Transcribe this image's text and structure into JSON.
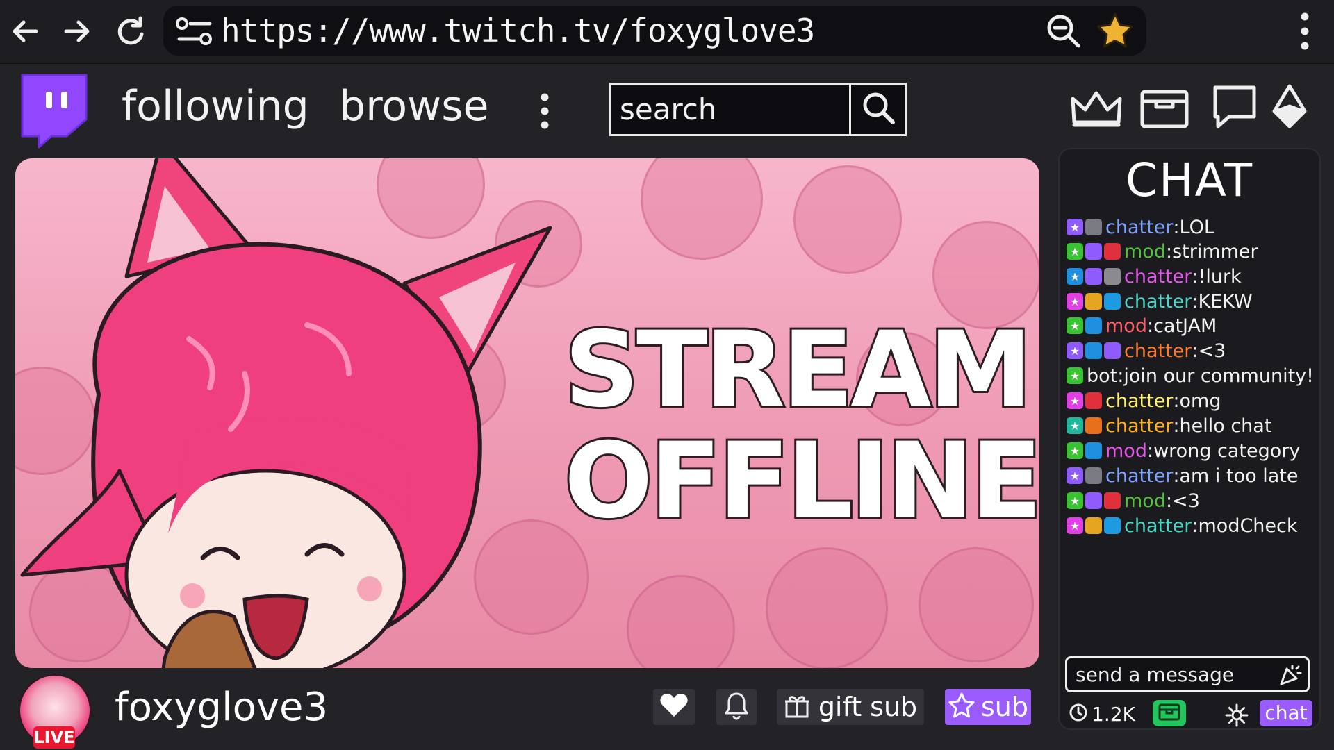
{
  "browser": {
    "url": "https://www.twitch.tv/foxyglove3"
  },
  "header": {
    "following_label": "following",
    "browse_label": "browse",
    "search_placeholder": "search"
  },
  "player": {
    "offline_line1": "STREAM",
    "offline_line2": "OFFLINE"
  },
  "chat": {
    "title": "CHAT",
    "message_placeholder": "send a message",
    "viewer_count": "1.2K",
    "chat_button_label": "chat",
    "messages": [
      {
        "badges": [
          "#8f5bff",
          "#7a7a82"
        ],
        "user": "chatter",
        "color": "#7ea3ff",
        "text": "LOL"
      },
      {
        "badges": [
          "#39c232",
          "#8f5bff",
          "#e0303c"
        ],
        "user": "mod",
        "color": "#54c13a",
        "text": "strimmer"
      },
      {
        "badges": [
          "#1f8fe0",
          "#8f5bff",
          "#8a8a90"
        ],
        "user": "chatter",
        "color": "#e557e8",
        "text": "!lurk"
      },
      {
        "badges": [
          "#e23fe6",
          "#e6a520",
          "#1c9be2"
        ],
        "user": "chatter",
        "color": "#48d6c6",
        "text": "KEKW"
      },
      {
        "badges": [
          "#39c232",
          "#1f8fe0"
        ],
        "user": "mod",
        "color": "#ff5f6a",
        "text": "catJAM"
      },
      {
        "badges": [
          "#8f5bff",
          "#1f8fe0",
          "#8f5bff"
        ],
        "user": "chatter",
        "color": "#ff7a2a",
        "text": "<3"
      },
      {
        "badges": [
          "#39c232"
        ],
        "user": "bot",
        "color": "#f2f2f2",
        "text": "join our community!"
      },
      {
        "badges": [
          "#e23fe6",
          "#e0303c"
        ],
        "user": "chatter",
        "color": "#fff06a",
        "text": "omg"
      },
      {
        "badges": [
          "#20b89c",
          "#e6701c"
        ],
        "user": "chatter",
        "color": "#ffb11a",
        "text": "hello chat"
      },
      {
        "badges": [
          "#39c232",
          "#1f8fe0"
        ],
        "user": "mod",
        "color": "#e557e8",
        "text": "wrong category"
      },
      {
        "badges": [
          "#8f5bff",
          "#7a7a82"
        ],
        "user": "chatter",
        "color": "#7ea3ff",
        "text": "am i too late"
      },
      {
        "badges": [
          "#39c232",
          "#8f5bff",
          "#e0303c"
        ],
        "user": "mod",
        "color": "#54c13a",
        "text": "<3"
      },
      {
        "badges": [
          "#e23fe6",
          "#e6a520",
          "#1c9be2"
        ],
        "user": "chatter",
        "color": "#48d6c6",
        "text": "modCheck"
      }
    ]
  },
  "channel": {
    "name": "foxyglove3",
    "live_badge": "LIVE",
    "gift_sub_label": "gift sub",
    "sub_label": "sub"
  },
  "colors": {
    "twitch_purple": "#9146ff",
    "sub_purple": "#9b5cff",
    "live_red": "#e9172f",
    "player_pink": "#f1a3bb"
  }
}
